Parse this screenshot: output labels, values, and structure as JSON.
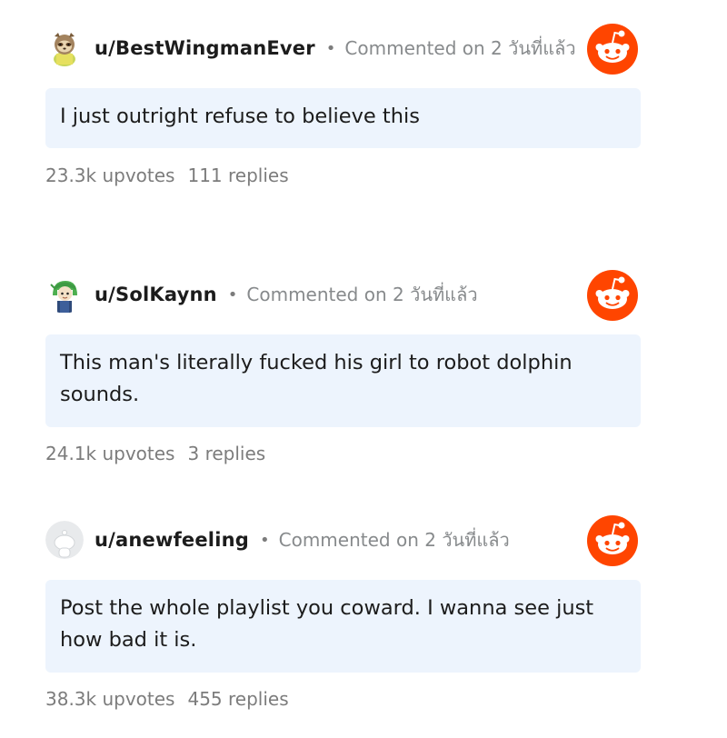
{
  "comments": [
    {
      "username": "u/BestWingmanEver",
      "separator": "•",
      "meta": "Commented on 2 วันที่แล้ว",
      "body": "I just outright refuse to believe this",
      "upvotes": "23.3k upvotes",
      "replies": "111 replies",
      "avatar_icon": "sloth-avatar-icon"
    },
    {
      "username": "u/SolKaynn",
      "separator": "•",
      "meta": "Commented on 2 วันที่แล้ว",
      "body": "This man's literally fucked his girl to robot dolphin sounds.",
      "upvotes": "24.1k upvotes",
      "replies": "3 replies",
      "avatar_icon": "green-hood-avatar-icon"
    },
    {
      "username": "u/anewfeeling",
      "separator": "•",
      "meta": "Commented on 2 วันที่แล้ว",
      "body": "Post the whole playlist you coward. I wanna see just how bad it is.",
      "upvotes": "38.3k upvotes",
      "replies": "455 replies",
      "avatar_icon": "default-avatar-icon"
    }
  ],
  "colors": {
    "reddit_orange": "#ff4500",
    "bubble_bg": "#edf4fd",
    "meta_gray": "#878a8c"
  },
  "logo_icon": "reddit-logo-icon"
}
